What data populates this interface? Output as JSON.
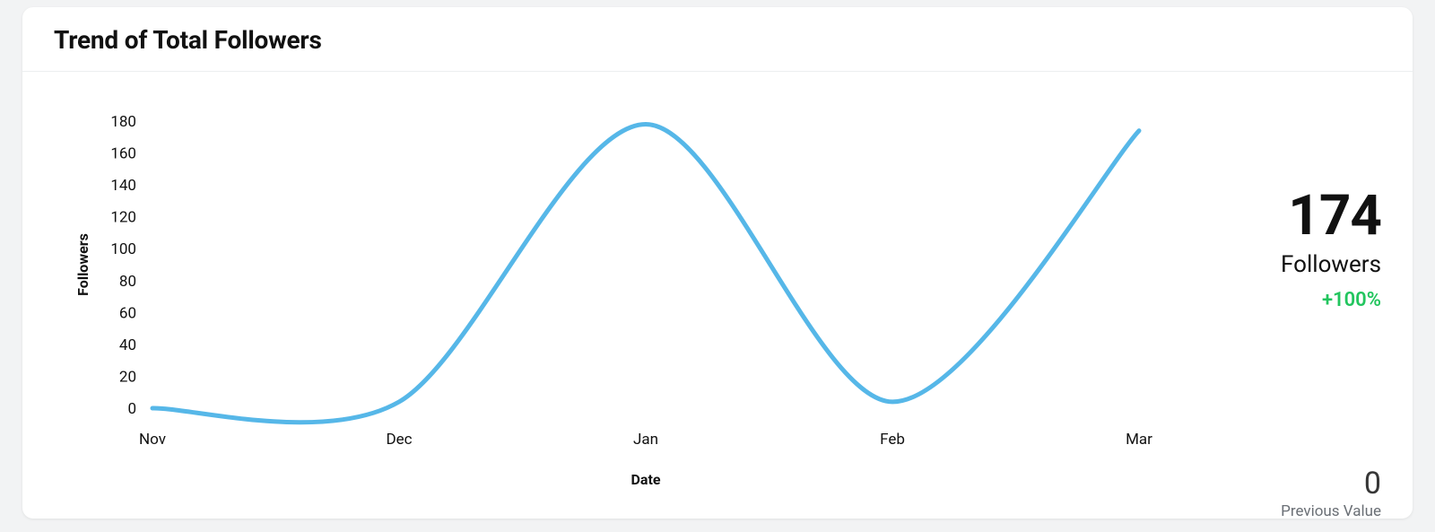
{
  "header": {
    "title": "Trend of Total Followers"
  },
  "stats": {
    "current_value": "174",
    "current_label": "Followers",
    "delta": "+100%",
    "delta_color": "#22c55e",
    "previous_value": "0",
    "previous_label": "Previous Value"
  },
  "chart_data": {
    "type": "line",
    "title": "Trend of Total Followers",
    "xlabel": "Date",
    "ylabel": "Followers",
    "ylim": [
      0,
      180
    ],
    "yticks": [
      0,
      20,
      40,
      60,
      80,
      100,
      120,
      140,
      160,
      180
    ],
    "categories": [
      "Nov",
      "Dec",
      "Jan",
      "Feb",
      "Mar"
    ],
    "values": [
      0,
      4,
      178,
      4,
      174
    ],
    "line_color": "#56b7e8"
  }
}
